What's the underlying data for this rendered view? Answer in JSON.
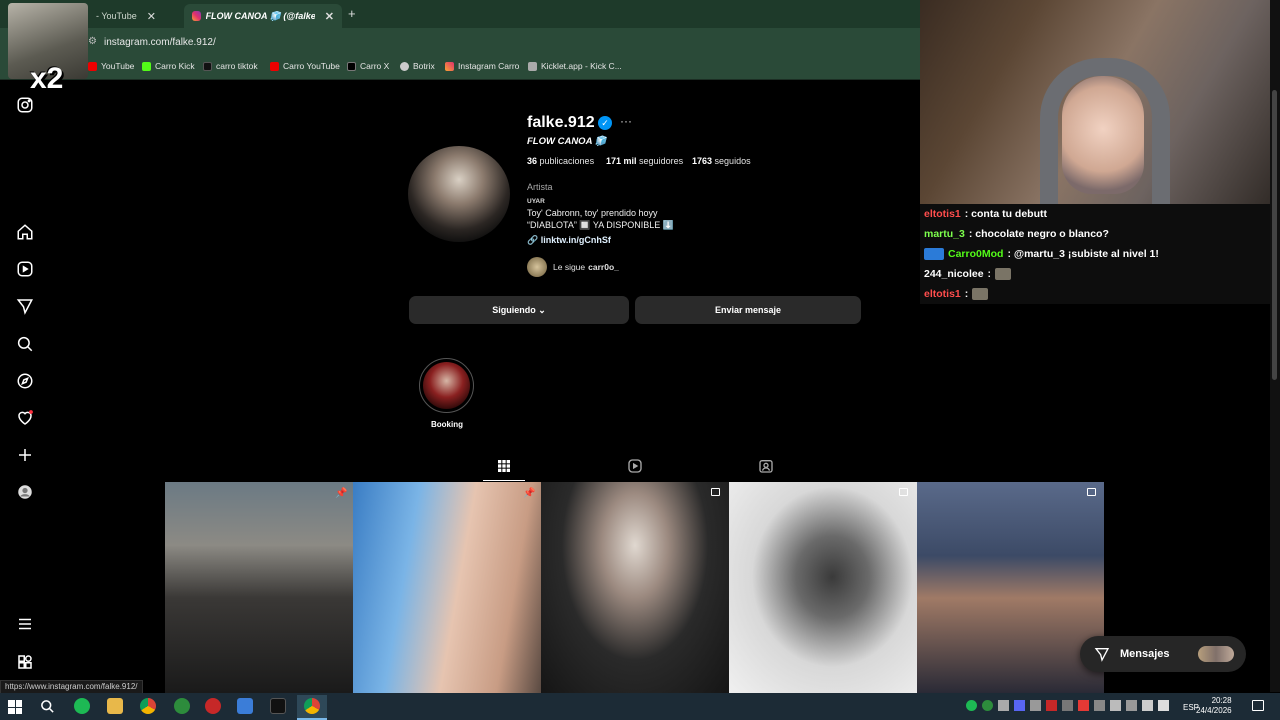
{
  "browser": {
    "tabs": [
      {
        "title": "- YouTube",
        "active": false
      },
      {
        "title": "FLOW CANOA 🧊 (@falke.912",
        "active": true
      }
    ],
    "url": "instagram.com/falke.912/",
    "bookmarks": [
      "YouTube",
      "Carro Kick",
      "carro tiktok",
      "Carro YouTube",
      "Carro X",
      "Botrix",
      "Instagram Carro",
      "Kicklet.app - Kick C..."
    ],
    "status_url": "https://www.instagram.com/falke.912/"
  },
  "overlay": {
    "multiplier": "x2"
  },
  "profile": {
    "username": "falke.912",
    "verified_mark": "✓",
    "more": "···",
    "full_name": "FLOW CANOA 🧊",
    "posts_count": "36",
    "posts_label": "publicaciones",
    "followers_count": "171 mil",
    "followers_label": "seguidores",
    "following_count": "1763",
    "following_label": "seguidos",
    "category": "Artista",
    "bio_heading": "UYAR",
    "bio_line1": "Toy' Cabronn, toy' prendido hoyy",
    "bio_line2": "“DIABLOTA” 🔲 YA DISPONIBLE ⬇️",
    "link": "linktw.in/gCnhSf",
    "followed_by_prefix": "Le sigue",
    "followed_by_user": "carr0o_",
    "following_button": "Siguiendo ⌄",
    "message_button": "Enviar mensaje",
    "highlight_label": "Booking"
  },
  "messages_button": "Mensajes",
  "chat": [
    {
      "user": "eltotis1",
      "color": "#ff4d4d",
      "text": ": conta tu debutt"
    },
    {
      "user": "martu_3",
      "color": "#7dff4d",
      "text": ": chocolate negro o blanco?"
    },
    {
      "user": "Carro0Mod",
      "color": "#53fc18",
      "text": ": @martu_3 ¡subiste al nivel 1!"
    },
    {
      "user": "244_nicolee",
      "color": "#ffffff",
      "text": ":"
    },
    {
      "user": "eltotis1",
      "color": "#ff4d4d",
      "text": ":"
    }
  ],
  "taskbar": {
    "language": "ESP",
    "time": "20:28",
    "date": "24/4/2026"
  },
  "icons": [
    "instagram-icon",
    "home-icon",
    "reels-icon",
    "send-icon",
    "search-icon",
    "explore-icon",
    "heart-icon",
    "create-icon",
    "profile-icon",
    "menu-icon",
    "apps-icon",
    "grid-icon",
    "reels-tab-icon",
    "tagged-icon",
    "pin-icon",
    "messages-icon"
  ]
}
